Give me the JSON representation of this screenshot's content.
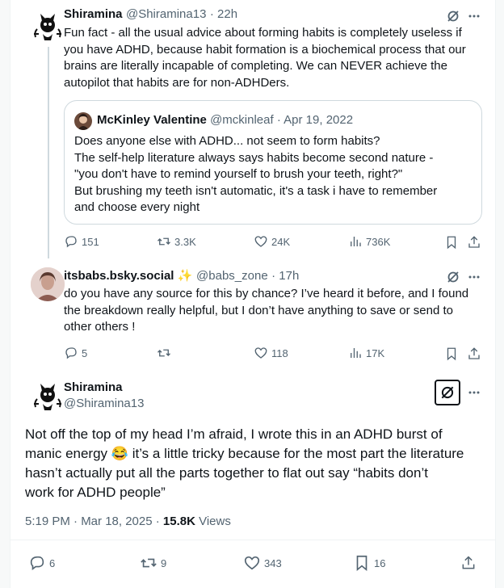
{
  "tweet1": {
    "name": "Shiramina",
    "handle": "@Shiramina13",
    "time": "· 22h",
    "text_lines": [
      "Fun fact - all the usual advice about forming habits is completely useless if",
      "you have ADHD, because habit formation is a biochemical process that our",
      "brains are literally incapable of completing. We can NEVER achieve the",
      "autopilot that habits are for non-ADHDers."
    ],
    "quote": {
      "name": "McKinley Valentine",
      "handle": "@mckinleaf",
      "time": "· Apr 19, 2022",
      "text_lines": [
        "Does anyone else with ADHD... not seem to form habits?",
        "The self-help literature always says habits become second nature -",
        "\"you don't have to remind yourself to brush your teeth, right?\"",
        "But brushing my teeth isn't automatic, it's a task i have to remember",
        "and choose every night"
      ]
    },
    "stats": {
      "replies": "151",
      "reposts": "3.3K",
      "likes": "24K",
      "views": "736K"
    }
  },
  "tweet2": {
    "name": "itsbabs.bsky.social",
    "handle": "@babs_zone",
    "time": "· 17h",
    "text_lines": [
      "do you have any source for this by chance? I’ve heard it before, and I found",
      "the breakdown really helpful, but I don’t have anything to save or send to",
      "other others !"
    ],
    "stats": {
      "replies": "5",
      "reposts": "",
      "likes": "118",
      "views": "17K"
    }
  },
  "tweet3": {
    "name": "Shiramina",
    "handle": "@Shiramina13",
    "text_lines": [
      "Not off the top of my head I’m afraid, I wrote this in an ADHD burst of",
      "manic energy",
      " it’s a little tricky because for the most part the literature",
      "hasn’t actually put all the parts together to flat out say “habits don’t",
      "work for ADHD people”"
    ],
    "emoji": "😂",
    "timestamp": "5:19 PM · Mar 18, 2025 · ",
    "views_count": "15.8K",
    "views_label": " Views",
    "stats": {
      "replies": "6",
      "reposts": "9",
      "likes": "343",
      "bookmarks": "16"
    }
  },
  "colors": {
    "text": "#0f1419",
    "muted": "#536471",
    "border": "#cfd9de"
  },
  "icons": [
    "more-icon",
    "grok-icon",
    "reply-icon",
    "repost-icon",
    "like-icon",
    "views-icon",
    "bookmark-icon",
    "share-icon",
    "sparkle-icon"
  ]
}
